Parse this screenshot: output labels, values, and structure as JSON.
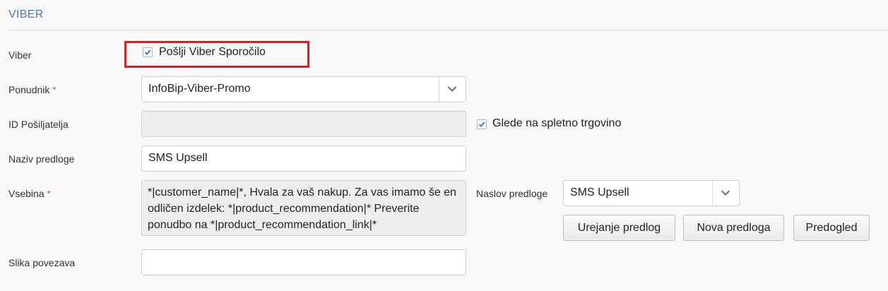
{
  "section": {
    "title": "VIBER"
  },
  "viber": {
    "label": "Viber",
    "send_checkbox": {
      "label": "Pošlji Viber Sporočilo",
      "checked": true
    }
  },
  "provider": {
    "label": "Ponudnik",
    "required_mark": "*",
    "value": "InfoBip-Viber-Promo",
    "icon": "chevron-down-icon"
  },
  "sender_id": {
    "label": "ID Pošiljatelja",
    "value": "",
    "webshop_checkbox": {
      "label": "Glede na spletno trgovino",
      "checked": true
    }
  },
  "template_name": {
    "label": "Naziv predloge",
    "value": "SMS Upsell"
  },
  "content": {
    "label": "Vsebina",
    "required_mark": "*",
    "value": "*|customer_name|*, Hvala za vaš nakup. Za vas imamo še en odličen izdelek: *|product_recommendation|* Preverite ponudbo na *|product_recommendation_link|*"
  },
  "template_title": {
    "label": "Naslov predloge",
    "value": "SMS Upsell",
    "icon": "chevron-down-icon"
  },
  "buttons": {
    "edit": "Urejanje predlog",
    "new": "Nova predloga",
    "preview": "Predogled"
  },
  "image_link": {
    "label": "Slika povezava",
    "value": ""
  },
  "colors": {
    "accent": "#4a7aa5",
    "required": "#d9534f",
    "highlight": "#e02020",
    "check": "#2a7fd4"
  }
}
